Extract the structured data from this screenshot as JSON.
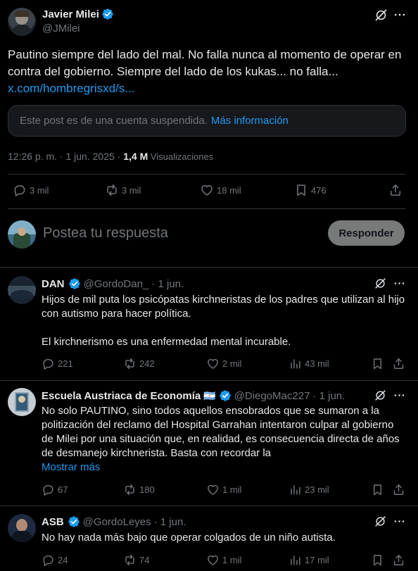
{
  "post": {
    "author_name": "Javier Milei",
    "author_handle": "@JMilei",
    "text": "Pautino siempre del lado del mal. No falla nunca al momento de operar en contra del gobierno. Siempre del lado de los kukas... no falla...",
    "link": "x.com/hombregrisxd/s...",
    "quoted_notice": "Este post es de una cuenta suspendida.",
    "quoted_more": "Más información",
    "timestamp": "12:26 p. m. · 1 jun. 2025 · ",
    "views_count": "1,4 M",
    "views_label": " Visualizaciones",
    "stats": {
      "replies": "3 mil",
      "reposts": "3 mil",
      "likes": "18 mil",
      "bookmarks": "476"
    }
  },
  "composer": {
    "placeholder": "Postea tu respuesta",
    "button": "Responder"
  },
  "replies": [
    {
      "name": "DAN",
      "handle": "@GordoDan_",
      "date": "· 1 jun.",
      "text1": "Hijos de mil puta los psicópatas kirchneristas de los padres que utilizan al hijo con autismo para hacer política.",
      "text2": "El kirchnerismo es una enfermedad mental incurable.",
      "replies": "221",
      "reposts": "242",
      "likes": "2 mil",
      "views": "43 mil"
    },
    {
      "name": "Escuela Austriaca de Economía",
      "flag": "🇦🇷",
      "handle": "@DiegoMac227",
      "date": "· 1 jun.",
      "text1": "No solo PAUTINO, sino todos aquellos ensobrados que se sumaron a la politización del reclamo del Hospital Garrahan intentaron culpar al gobierno de Milei por una situación que, en realidad, es consecuencia directa de años de desmanejo kirchnerista. Basta con recordar la",
      "show_more": "Mostrar más",
      "replies": "67",
      "reposts": "180",
      "likes": "1 mil",
      "views": "23 mil"
    },
    {
      "name": "ASB",
      "handle": "@GordoLeyes",
      "date": "· 1 jun.",
      "text1": "No hay nada más bajo que operar colgados de un niño autista.",
      "replies": "24",
      "reposts": "74",
      "likes": "1 mil",
      "views": "17 mil"
    }
  ],
  "icons": {
    "grok": "grok-icon",
    "more": "more-icon",
    "reply": "reply-icon",
    "repost": "repost-icon",
    "like": "like-icon",
    "views": "views-icon",
    "bookmark": "bookmark-icon",
    "share": "share-icon",
    "verified": "verified-badge-icon"
  },
  "colors": {
    "background": "#000000",
    "text": "#e7e9ea",
    "muted": "#71767b",
    "link": "#1d9bf0",
    "border": "#2f3336",
    "button_bg": "#787a7a"
  }
}
